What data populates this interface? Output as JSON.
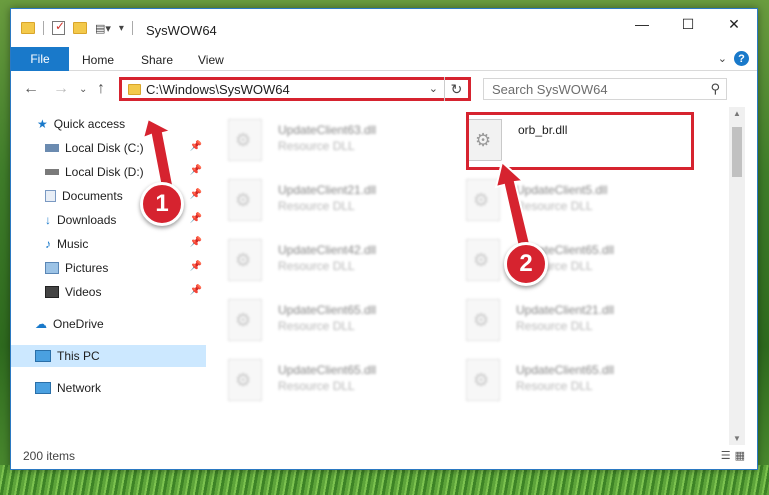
{
  "window": {
    "title": "SysWOW64",
    "controls": {
      "minimize": "—",
      "maximize": "☐",
      "close": "✕"
    }
  },
  "ribbon": {
    "file": "File",
    "tabs": [
      "Home",
      "Share",
      "View"
    ],
    "help": "?"
  },
  "address": {
    "path": "C:\\Windows\\SysWOW64",
    "search_placeholder": "Search SysWOW64"
  },
  "nav": {
    "quick_access": "Quick access",
    "items": [
      "Local Disk (C:)",
      "Local Disk (D:)",
      "Documents",
      "Downloads",
      "Music",
      "Pictures",
      "Videos"
    ],
    "onedrive": "OneDrive",
    "this_pc": "This PC",
    "network": "Network"
  },
  "files": {
    "highlighted": {
      "name": "orb_br.dll"
    },
    "left_col": [
      {
        "name": "UpdateClient63.dll",
        "type": "Resource DLL"
      },
      {
        "name": "UpdateClient21.dll",
        "type": "Resource DLL"
      },
      {
        "name": "UpdateClient42.dll",
        "type": "Resource DLL"
      },
      {
        "name": "UpdateClient65.dll",
        "type": "Resource DLL"
      },
      {
        "name": "UpdateClient65.dll",
        "type": "Resource DLL"
      }
    ],
    "right_col": [
      {
        "name": "UpdateClient5.dll",
        "type": "Resource DLL"
      },
      {
        "name": "UpdateClient65.dll",
        "type": "Resource DLL"
      },
      {
        "name": "UpdateClient21.dll",
        "type": "Resource DLL"
      },
      {
        "name": "UpdateClient65.dll",
        "type": "Resource DLL"
      }
    ]
  },
  "status": {
    "count": "200 items"
  },
  "annotations": {
    "step1": "1",
    "step2": "2",
    "color": "#d6232f"
  }
}
